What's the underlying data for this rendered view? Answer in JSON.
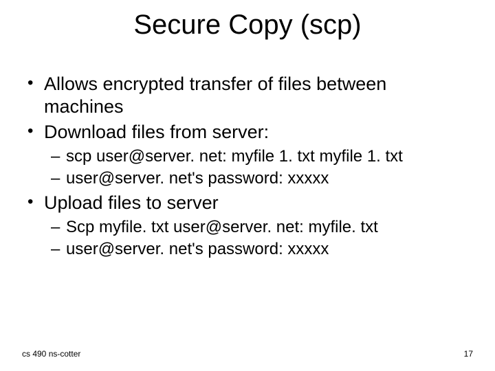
{
  "title": "Secure Copy (scp)",
  "bullets": {
    "b1": "Allows encrypted transfer of files between machines",
    "b2": "Download files from server:",
    "b2s1": "scp user@server. net: myfile 1. txt myfile 1. txt",
    "b2s2": "user@server. net's password: xxxxx",
    "b3": "Upload files to server",
    "b3s1": "Scp myfile. txt user@server. net: myfile. txt",
    "b3s2": "user@server. net's password: xxxxx"
  },
  "footer": {
    "left": "cs 490 ns-cotter",
    "right": "17"
  }
}
